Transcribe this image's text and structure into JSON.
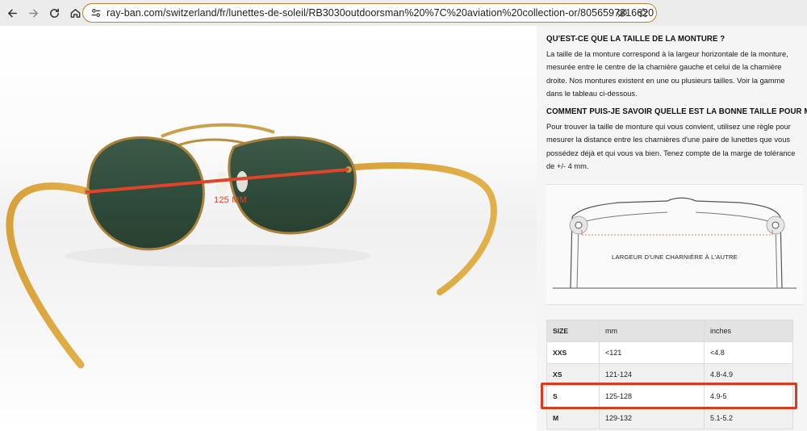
{
  "browser": {
    "url": "ray-ban.com/switzerland/fr/lunettes-de-soleil/RB3030outdoorsman%20%7C%20aviation%20collection-or/8056597316620",
    "icons": [
      "back-arrow-icon",
      "forward-arrow-icon",
      "reload-icon",
      "home-icon",
      "site-settings-icon",
      "eye-off-icon",
      "star-icon"
    ]
  },
  "photo": {
    "measure_label": "125 MM",
    "accent_color": "#e0442a"
  },
  "content": {
    "q1_title": "QU'EST-CE QUE LA TAILLE DE LA MONTURE ?",
    "q1_text": "La taille de la monture correspond à la largeur horizontale de la monture, mesurée entre le centre de la charnière gauche et celui de la charnière droite. Nos montures existent en une ou plusieurs tailles. Voir la gamme dans le tableau ci-dessous.",
    "q2_title": "COMMENT PUIS-JE SAVOIR QUELLE EST LA BONNE TAILLE POUR MOI ?",
    "q2_text": "Pour trouver la taille de monture qui vous convient, utilisez une règle pour mesurer la distance entre les charnières d'une paire de lunettes que vous possédez déjà et qui vous va bien. Tenez compte de la marge de tolérance de +/- 4 mm.",
    "diagram_label": "LARGEUR D'UNE CHARNIÈRE À L'AUTRE"
  },
  "size_table": {
    "headers": [
      "SIZE",
      "mm",
      "inches"
    ],
    "rows": [
      [
        "XXS",
        "<121",
        "<4.8"
      ],
      [
        "XS",
        "121-124",
        "4.8-4.9"
      ],
      [
        "S",
        "125-128",
        "4.9-5"
      ],
      [
        "M",
        "129-132",
        "5.1-5.2"
      ]
    ],
    "highlight_color": "#d83a22"
  }
}
